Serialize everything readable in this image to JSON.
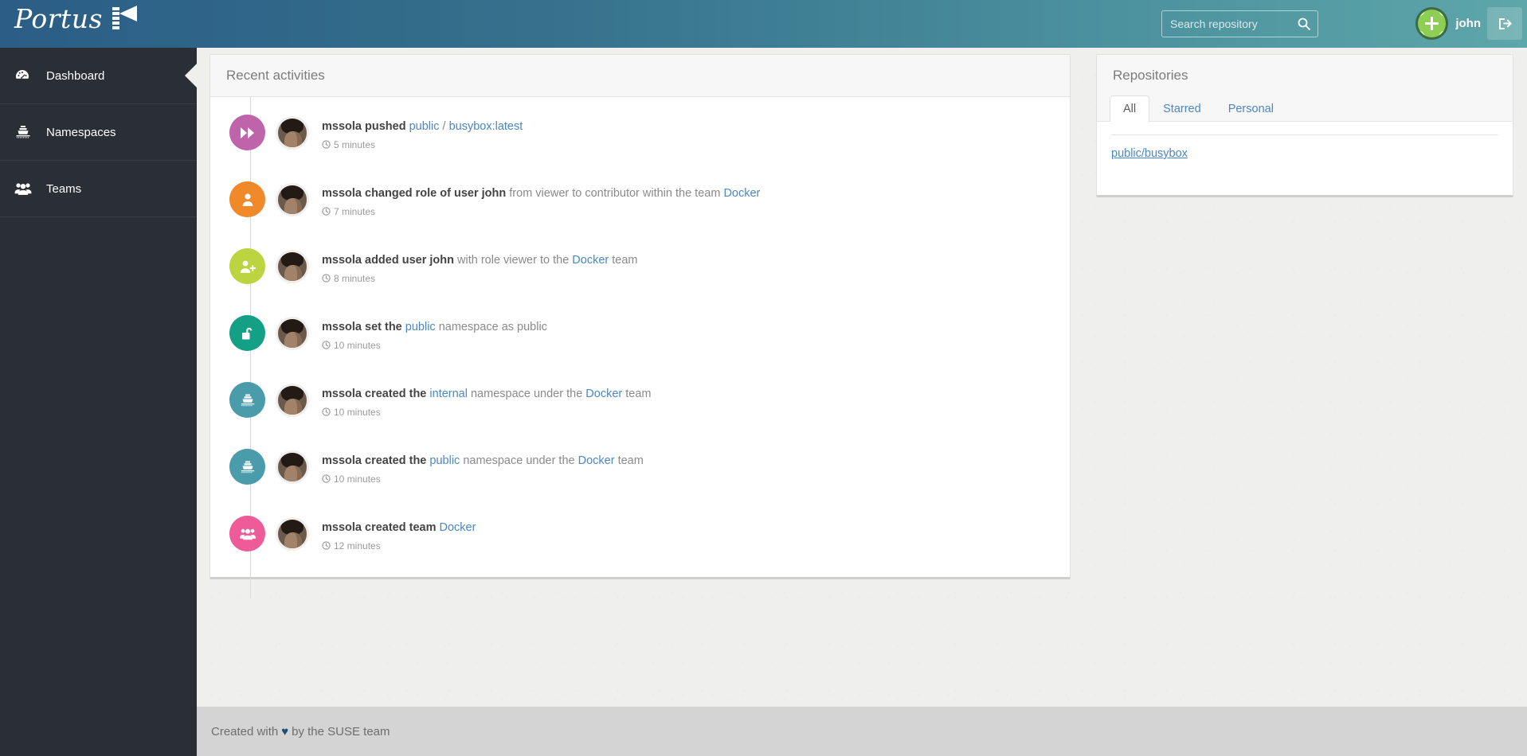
{
  "header": {
    "logo_text": "Portus",
    "logo_icon": "lighthouse-icon",
    "search_placeholder": "Search repository",
    "search_value": "",
    "search_icon": "search-icon",
    "username": "john",
    "logout_icon": "sign-out-icon"
  },
  "sidebar": {
    "items": [
      {
        "label": "Dashboard",
        "icon": "dashboard-gauge-icon",
        "active": true
      },
      {
        "label": "Namespaces",
        "icon": "ship-icon",
        "active": false
      },
      {
        "label": "Teams",
        "icon": "users-group-icon",
        "active": false
      }
    ]
  },
  "activities_panel": {
    "title": "Recent activities",
    "items": [
      {
        "icon": "fast-forward-icon",
        "icon_color": "#bf63aa",
        "actor": "mssola pushed",
        "rest_prefix": "",
        "links": [
          {
            "text": "public"
          },
          {
            "text": "busybox:latest"
          }
        ],
        "separator": " / ",
        "rest_suffix": "",
        "time": "5 minutes"
      },
      {
        "icon": "user-icon",
        "icon_color": "#f0892a",
        "actor": "mssola changed role of user john",
        "rest_prefix": " from viewer to contributor within the team ",
        "link": "Docker",
        "rest_suffix": "",
        "time": "7 minutes"
      },
      {
        "icon": "user-plus-icon",
        "icon_color": "#bcd440",
        "actor": "mssola added user john",
        "rest_prefix": " with role viewer to the ",
        "link": "Docker",
        "rest_suffix": " team",
        "time": "8 minutes"
      },
      {
        "icon": "unlock-icon",
        "icon_color": "#13a085",
        "actor": "mssola set the",
        "rest_prefix": " ",
        "link": "public",
        "rest_suffix": " namespace as public",
        "time": "10 minutes"
      },
      {
        "icon": "ship-icon",
        "icon_color": "#4a9cab",
        "actor": "mssola created the",
        "rest_prefix": " ",
        "link": "internal",
        "rest_suffix": " namespace under the ",
        "link2": "Docker",
        "rest_suffix2": " team",
        "time": "10 minutes"
      },
      {
        "icon": "ship-icon",
        "icon_color": "#4a9cab",
        "actor": "mssola created the",
        "rest_prefix": " ",
        "link": "public",
        "rest_suffix": " namespace under the ",
        "link2": "Docker",
        "rest_suffix2": " team",
        "time": "10 minutes"
      },
      {
        "icon": "users-group-icon",
        "icon_color": "#ee5b98",
        "actor": "mssola created team",
        "rest_prefix": " ",
        "link": "Docker",
        "rest_suffix": "",
        "time": "12 minutes"
      }
    ]
  },
  "repositories_panel": {
    "title": "Repositories",
    "tabs": [
      {
        "label": "All",
        "active": true
      },
      {
        "label": "Starred",
        "active": false
      },
      {
        "label": "Personal",
        "active": false
      }
    ],
    "items": [
      {
        "label": "public/busybox"
      }
    ]
  },
  "footer": {
    "prefix": "Created with",
    "heart_icon": "heart-icon",
    "heart": "♥",
    "suffix": "by the SUSE team"
  },
  "colors": {
    "header_gradient_start": "#2b5d86",
    "header_gradient_end": "#5da6a9",
    "sidebar_bg": "#2a2e35",
    "link": "#4a87c4",
    "heart": "#1f4f73",
    "footer_bg": "#d4d4d4",
    "page_bg": "#efefed"
  }
}
